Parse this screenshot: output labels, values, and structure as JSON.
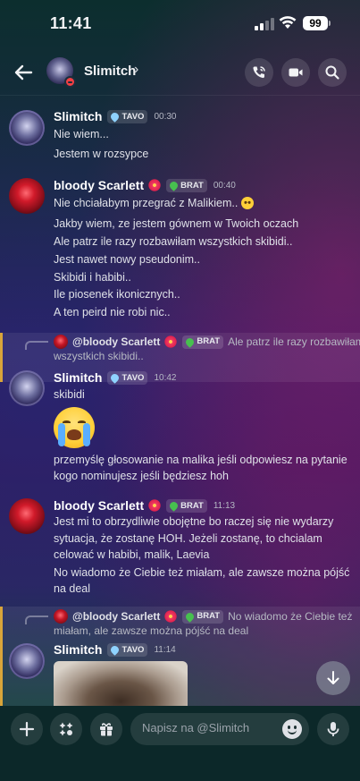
{
  "status_bar": {
    "time": "11:41",
    "battery": "99"
  },
  "header": {
    "title": "Slimitch",
    "chevron": "›"
  },
  "tags": {
    "tavo": "TAVO",
    "brat": "BRAT"
  },
  "colors": {
    "tavo_icon": "#8fd3ff",
    "brat_icon": "#47c04f",
    "reply_accent": "#d9a53a",
    "dnd": "#f23f43"
  },
  "messages": [
    {
      "author": "Slimitch",
      "timestamp": "00:30",
      "lines": [
        "Nie wiem...",
        "Jestem w rozsypce"
      ]
    },
    {
      "author": "bloody Scarlett",
      "timestamp": "00:40",
      "lines": [
        "Nie chciałabym przegrać z Malikiem..",
        "Jakby wiem, ze jestem gównem w Twoich oczach",
        "Ale patrz ile razy rozbawiłam wszystkich skibidi..",
        "Jest nawet nowy pseudonim..",
        "Skibidi i habibi..",
        "Ile piosenek ikonicznych..",
        "A ten peird nie robi nic.."
      ]
    },
    {
      "reply": {
        "author": "@bloody Scarlett",
        "line1": "Ale patrz ile razy rozbawiłam",
        "line2": "wszystkich skibidi.."
      },
      "author": "Slimitch",
      "timestamp": "10:42",
      "lines": [
        "skibidi",
        "przemyślę głosowanie na malika jeśli odpowiesz na pytanie",
        "kogo nominujesz jeśli będziesz hoh"
      ]
    },
    {
      "author": "bloody Scarlett",
      "timestamp": "11:13",
      "lines": [
        "Jest mi to obrzydliwie obojętne bo raczej się nie wydarzy",
        "sytuacja, że zostanę HOH. Jeżeli zostanę, to chcialam",
        "celować w habibi, malik, Laevia",
        "No wiadomo że Ciebie też miałam, ale zawsze można pójść",
        "na deal"
      ]
    },
    {
      "reply": {
        "author": "@bloody Scarlett",
        "line1": "No wiadomo że Ciebie też",
        "line2": "miałam, ale zawsze można pójść na deal"
      },
      "author": "Slimitch",
      "timestamp": "11:14"
    }
  ],
  "composer": {
    "placeholder": "Napisz na @Slimitch"
  },
  "icons": {
    "back": "arrow-left-icon",
    "call": "phone-call-icon",
    "video": "video-camera-icon",
    "search": "search-icon",
    "plus": "plus-icon",
    "apps": "apps-icon",
    "gift": "gift-icon",
    "emoji": "emoji-icon",
    "mic": "microphone-icon",
    "scroll": "arrow-down-icon",
    "cry": "loudly-crying-face-emoji"
  }
}
